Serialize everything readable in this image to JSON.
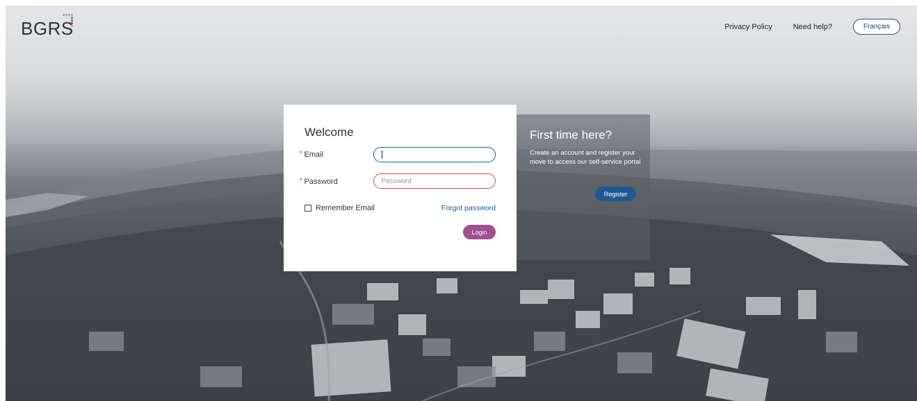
{
  "header": {
    "logo_text": "BGRS",
    "nav": {
      "privacy": "Privacy Policy",
      "help": "Need help?",
      "language": "Français"
    }
  },
  "login": {
    "title": "Welcome",
    "email_label": "Email",
    "password_label": "Password",
    "email_value": "",
    "password_placeholder": "Password",
    "remember_label": "Remember Email",
    "remember_checked": false,
    "forgot_label": "Forgot password",
    "login_label": "Login",
    "required_marker": "*"
  },
  "register_panel": {
    "title": "First time here?",
    "text": "Create an account and register your move to access our self-service portal",
    "button_label": "Register"
  },
  "colors": {
    "primary_blue": "#1d5a94",
    "login_purple": "#a0508f",
    "error_red": "#cf4b4b"
  },
  "icons": [
    "checkbox-icon"
  ]
}
